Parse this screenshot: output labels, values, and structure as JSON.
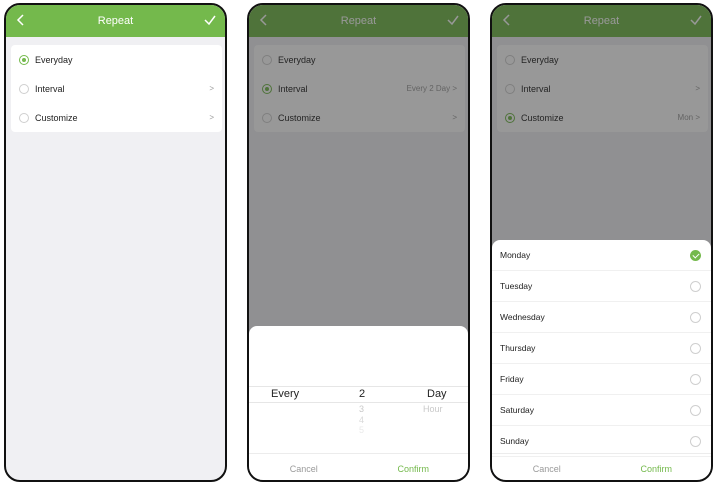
{
  "screen1": {
    "header": {
      "title": "Repeat",
      "back_icon": "chevron-left-icon",
      "confirm_icon": "checkmark-icon"
    },
    "options": [
      {
        "label": "Everyday",
        "selected": true,
        "value": "",
        "chevron": ""
      },
      {
        "label": "Interval",
        "selected": false,
        "value": "",
        "chevron": ">"
      },
      {
        "label": "Customize",
        "selected": false,
        "value": "",
        "chevron": ">"
      }
    ]
  },
  "screen2": {
    "header": {
      "title": "Repeat"
    },
    "options": [
      {
        "label": "Everyday",
        "selected": false,
        "value": ""
      },
      {
        "label": "Interval",
        "selected": true,
        "value": "Every 2 Day >"
      },
      {
        "label": "Customize",
        "selected": false,
        "value": ">"
      }
    ],
    "picker": {
      "label": "Every",
      "number_selected": "2",
      "number_next": [
        "3",
        "4",
        "5"
      ],
      "unit_selected": "Day",
      "unit_next": "Hour"
    },
    "footer": {
      "cancel": "Cancel",
      "confirm": "Confirm"
    }
  },
  "screen3": {
    "header": {
      "title": "Repeat"
    },
    "options": [
      {
        "label": "Everyday",
        "selected": false,
        "value": ""
      },
      {
        "label": "Interval",
        "selected": false,
        "value": ">"
      },
      {
        "label": "Customize",
        "selected": true,
        "value": "Mon >"
      }
    ],
    "days": [
      {
        "label": "Monday",
        "checked": true
      },
      {
        "label": "Tuesday",
        "checked": false
      },
      {
        "label": "Wednesday",
        "checked": false
      },
      {
        "label": "Thursday",
        "checked": false
      },
      {
        "label": "Friday",
        "checked": false
      },
      {
        "label": "Saturday",
        "checked": false
      },
      {
        "label": "Sunday",
        "checked": false
      }
    ],
    "footer": {
      "cancel": "Cancel",
      "confirm": "Confirm"
    }
  },
  "colors": {
    "accent": "#74b94c",
    "background": "#f0f0f3",
    "overlay": "rgba(40,40,40,0.48)"
  }
}
